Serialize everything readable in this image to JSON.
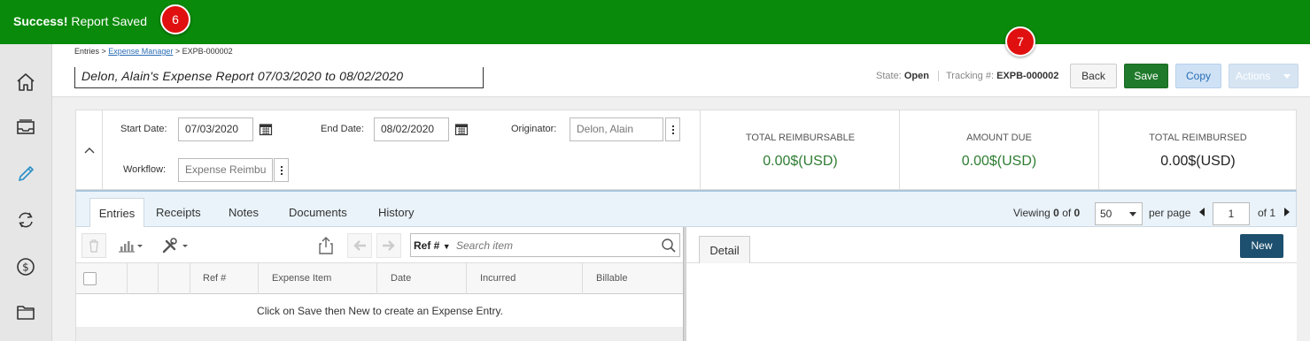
{
  "banner": {
    "success_strong": "Success!",
    "success_rest": " Report Saved",
    "step_a": "6",
    "step_b": "7"
  },
  "breadcrumb": {
    "entries": "Entries",
    "sep1": " > ",
    "expense_manager": "Expense Manager",
    "sep2": " > ",
    "current": "EXPB-000002"
  },
  "report": {
    "title": "Delon, Alain's Expense Report 07/03/2020 to 08/02/2020",
    "state_label": "State:",
    "state_value": "Open",
    "tracking_label": "Tracking #:",
    "tracking_value": "EXPB-000002"
  },
  "header_buttons": {
    "back": "Back",
    "save": "Save",
    "copy": "Copy",
    "actions": "Actions"
  },
  "form": {
    "start_date_label": "Start Date:",
    "start_date": "07/03/2020",
    "end_date_label": "End Date:",
    "end_date": "08/02/2020",
    "originator_label": "Originator:",
    "originator": "Delon, Alain",
    "workflow_label": "Workflow:",
    "workflow": "Expense Reimbu"
  },
  "summary": [
    {
      "title": "TOTAL REIMBURSABLE",
      "value": "0.00$(USD)",
      "color": "#2e7d32"
    },
    {
      "title": "AMOUNT DUE",
      "value": "0.00$(USD)",
      "color": "#2e7d32"
    },
    {
      "title": "TOTAL REIMBURSED",
      "value": "0.00$(USD)",
      "color": "#222222"
    }
  ],
  "tabs": [
    "Entries",
    "Receipts",
    "Notes",
    "Documents",
    "History"
  ],
  "pager": {
    "viewing_label": "Viewing",
    "viewing_from": "0",
    "of_label": "of",
    "viewing_total": "0",
    "per_page_value": "50",
    "per_page_label": "per page",
    "page": "1",
    "of_pages": "of 1"
  },
  "search": {
    "field": "Ref #",
    "placeholder": "Search item"
  },
  "grid": {
    "columns": [
      "Ref #",
      "Expense Item",
      "Date",
      "Incurred",
      "Billable"
    ],
    "empty_message": "Click on Save then New to create an Expense Entry."
  },
  "detail": {
    "tab": "Detail",
    "new_button": "New"
  },
  "icons": {
    "rail": [
      "home-icon",
      "inbox-icon",
      "pencil-icon",
      "sync-icon",
      "dollar-icon",
      "folder-icon"
    ]
  },
  "colors": {
    "banner_green": "#0a8a0a",
    "save_green": "#1f7a2b",
    "link_blue": "#2a6db5",
    "new_button": "#1d4f6e"
  }
}
